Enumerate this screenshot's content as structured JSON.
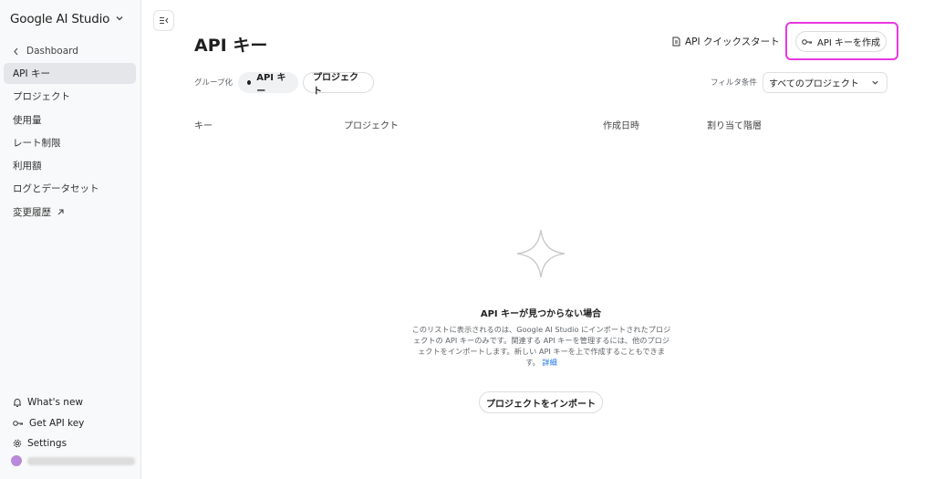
{
  "sidebar": {
    "brand": "Google AI Studio",
    "back_label": "Dashboard",
    "items": [
      {
        "label": "API キー",
        "active": true
      },
      {
        "label": "プロジェクト"
      },
      {
        "label": "使用量"
      },
      {
        "label": "レート制限"
      },
      {
        "label": "利用額"
      },
      {
        "label": "ログとデータセット"
      },
      {
        "label": "変更履歴"
      }
    ],
    "bottom": {
      "whats_new": "What's new",
      "get_api_key": "Get API key",
      "settings": "Settings"
    }
  },
  "header": {
    "title": "API キー",
    "quickstart_label": "API クイックスタート",
    "create_label": "API キーを作成"
  },
  "toolbar": {
    "group_label": "グループ化",
    "chip_api_keys": "API キー",
    "chip_projects": "プロジェクト",
    "filter_label": "フィルタ条件",
    "filter_value": "すべてのプロジェクト"
  },
  "table": {
    "columns": [
      "キー",
      "プロジェクト",
      "作成日時",
      "割り当て階層"
    ]
  },
  "empty_state": {
    "title": "API キーが見つからない場合",
    "description": "このリストに表示されるのは、Google AI Studio にインポートされたプロジェクトの API キーのみです。関連する API キーを管理するには、他のプロジェクトをインポートします。新しい API キーを上で作成することもできます。",
    "link": "詳細",
    "import_button": "プロジェクトをインポート"
  },
  "colors": {
    "highlight": "#e838e0",
    "link": "#1a73e8",
    "sidebar_bg": "#f8f9fa",
    "active_item_bg": "#e4e6e9"
  }
}
